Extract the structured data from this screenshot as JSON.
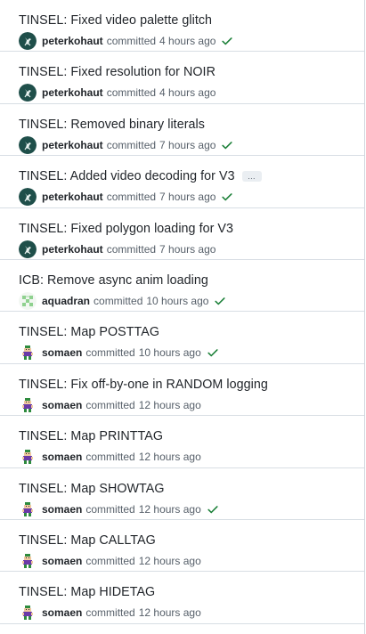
{
  "colors": {
    "check": "#1a7f37",
    "avatar_peter": "#1f4f4a",
    "avatar_aqua": "#8fd18f",
    "avatar_somaen": "#6b3aa8"
  },
  "verb": "committed",
  "commits": [
    {
      "title": "TINSEL: Fixed video palette glitch",
      "author": "peterkohaut",
      "avatar": "peter",
      "time": "4 hours ago",
      "check": true,
      "ellipsis": false
    },
    {
      "title": "TINSEL: Fixed resolution for NOIR",
      "author": "peterkohaut",
      "avatar": "peter",
      "time": "4 hours ago",
      "check": false,
      "ellipsis": false
    },
    {
      "title": "TINSEL: Removed binary literals",
      "author": "peterkohaut",
      "avatar": "peter",
      "time": "7 hours ago",
      "check": true,
      "ellipsis": false
    },
    {
      "title": "TINSEL: Added video decoding for V3",
      "author": "peterkohaut",
      "avatar": "peter",
      "time": "7 hours ago",
      "check": true,
      "ellipsis": true,
      "ellipsis_label": "…"
    },
    {
      "title": "TINSEL: Fixed polygon loading for V3",
      "author": "peterkohaut",
      "avatar": "peter",
      "time": "7 hours ago",
      "check": false,
      "ellipsis": false
    },
    {
      "title": "ICB: Remove async anim loading",
      "author": "aquadran",
      "avatar": "aqua",
      "time": "10 hours ago",
      "check": true,
      "ellipsis": false
    },
    {
      "title": "TINSEL: Map POSTTAG",
      "author": "somaen",
      "avatar": "somaen",
      "time": "10 hours ago",
      "check": true,
      "ellipsis": false
    },
    {
      "title": "TINSEL: Fix off-by-one in RANDOM logging",
      "author": "somaen",
      "avatar": "somaen",
      "time": "12 hours ago",
      "check": false,
      "ellipsis": false
    },
    {
      "title": "TINSEL: Map PRINTTAG",
      "author": "somaen",
      "avatar": "somaen",
      "time": "12 hours ago",
      "check": false,
      "ellipsis": false
    },
    {
      "title": "TINSEL: Map SHOWTAG",
      "author": "somaen",
      "avatar": "somaen",
      "time": "12 hours ago",
      "check": true,
      "ellipsis": false
    },
    {
      "title": "TINSEL: Map CALLTAG",
      "author": "somaen",
      "avatar": "somaen",
      "time": "12 hours ago",
      "check": false,
      "ellipsis": false
    },
    {
      "title": "TINSEL: Map HIDETAG",
      "author": "somaen",
      "avatar": "somaen",
      "time": "12 hours ago",
      "check": false,
      "ellipsis": false
    }
  ]
}
